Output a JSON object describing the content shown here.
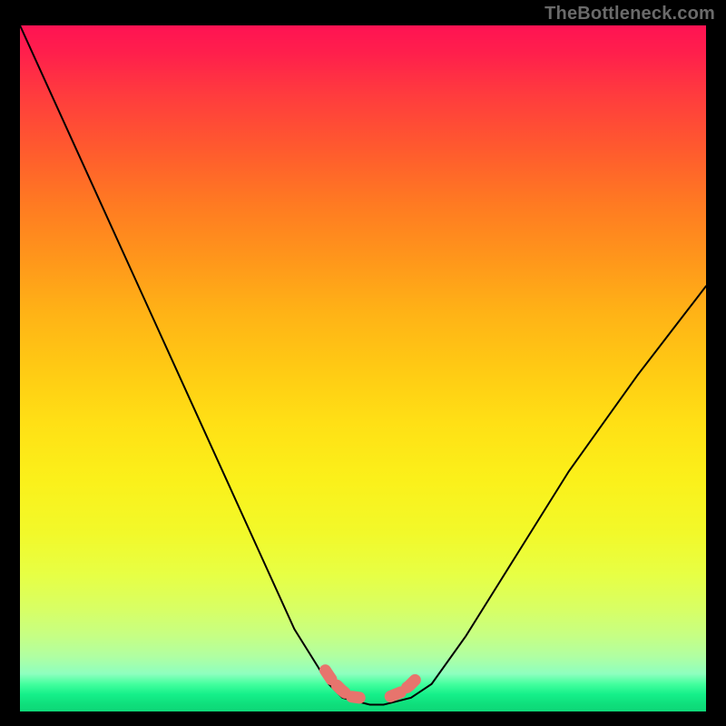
{
  "watermark": "TheBottleneck.com",
  "chart_data": {
    "type": "line",
    "title": "",
    "xlabel": "",
    "ylabel": "",
    "xlim": [
      0,
      1
    ],
    "ylim": [
      0,
      1
    ],
    "grid": false,
    "legend": false,
    "annotations": [
      {
        "text": "TheBottleneck.com",
        "position": "top-right",
        "color": "#6a6a6a"
      }
    ],
    "series": [
      {
        "name": "curve",
        "color": "#000000",
        "x": [
          0.0,
          0.05,
          0.1,
          0.15,
          0.2,
          0.25,
          0.3,
          0.35,
          0.4,
          0.45,
          0.47,
          0.49,
          0.51,
          0.53,
          0.55,
          0.57,
          0.6,
          0.65,
          0.7,
          0.75,
          0.8,
          0.85,
          0.9,
          0.95,
          1.0
        ],
        "y": [
          1.0,
          0.89,
          0.78,
          0.67,
          0.56,
          0.45,
          0.34,
          0.23,
          0.12,
          0.04,
          0.02,
          0.015,
          0.01,
          0.01,
          0.015,
          0.02,
          0.04,
          0.11,
          0.19,
          0.27,
          0.35,
          0.42,
          0.49,
          0.555,
          0.62
        ]
      },
      {
        "name": "bottom-markers",
        "color": "#e7746d",
        "type": "scatter",
        "x": [
          0.445,
          0.455,
          0.468,
          0.48,
          0.495,
          0.54,
          0.555,
          0.568,
          0.58
        ],
        "y": [
          0.06,
          0.045,
          0.032,
          0.022,
          0.02,
          0.022,
          0.028,
          0.038,
          0.05
        ]
      }
    ],
    "background_gradient": {
      "direction": "vertical",
      "stops": [
        {
          "pos": 0.0,
          "color": "#ff1353"
        },
        {
          "pos": 0.5,
          "color": "#ffca14"
        },
        {
          "pos": 0.8,
          "color": "#e7ff44"
        },
        {
          "pos": 0.96,
          "color": "#43ff9e"
        },
        {
          "pos": 1.0,
          "color": "#0ed878"
        }
      ]
    }
  }
}
